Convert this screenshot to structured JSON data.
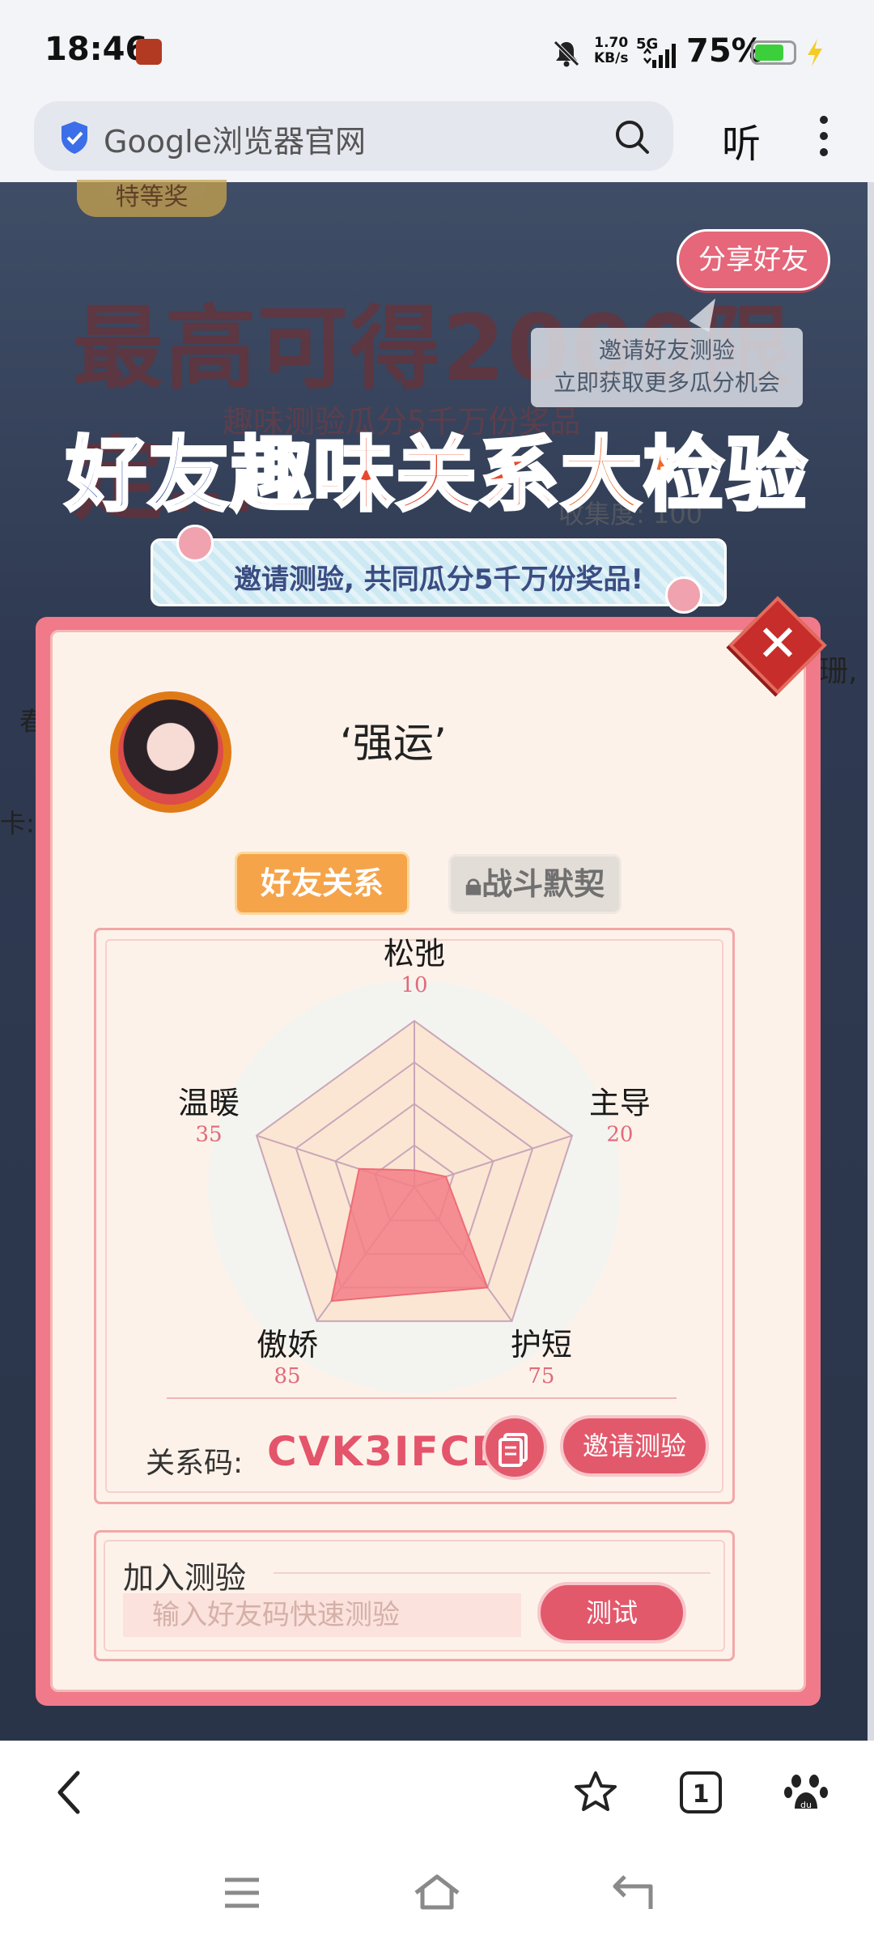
{
  "status_bar": {
    "time": "18:46",
    "net_speed_value": "1.70",
    "net_speed_unit": "KB/s",
    "network": "5G",
    "battery": "75%",
    "battery_level": 0.75
  },
  "browser": {
    "url_text": "Google浏览器官网",
    "listen_label": "听"
  },
  "background": {
    "prize_tag": "特等奖",
    "headline": "最高可得2000限定…",
    "subline": "趣味测验瓜分5千万份奖品",
    "collect": "收集度: 100",
    "side1": "珊,",
    "side2": "春",
    "side3": "卡:"
  },
  "share": {
    "button_label": "分享好友",
    "tip_line1": "邀请好友测验",
    "tip_line2": "立即获取更多瓜分机会"
  },
  "banner": {
    "title_part1": "好友",
    "title_part2": "趣味关系",
    "title_part3": "大检验",
    "invite_text": "邀请测验, 共同瓜分5千万份奖品!"
  },
  "modal": {
    "username": "‘强运’",
    "tabs": {
      "friend": "好友关系",
      "battle": "战斗默契"
    },
    "relation_code_label": "关系码:",
    "relation_code": "CVK3IFCB",
    "invite_button": "邀请测验",
    "join_label": "加入测验",
    "join_placeholder": "输入好友码快速测验",
    "test_button": "测试"
  },
  "chart_data": {
    "type": "radar",
    "axes": [
      "松弛",
      "主导",
      "护短",
      "傲娇",
      "温暖"
    ],
    "values": [
      10,
      20,
      75,
      85,
      35
    ],
    "max": 100,
    "fill_color": "#f37e86",
    "grid_color": "#c9a6b9"
  }
}
